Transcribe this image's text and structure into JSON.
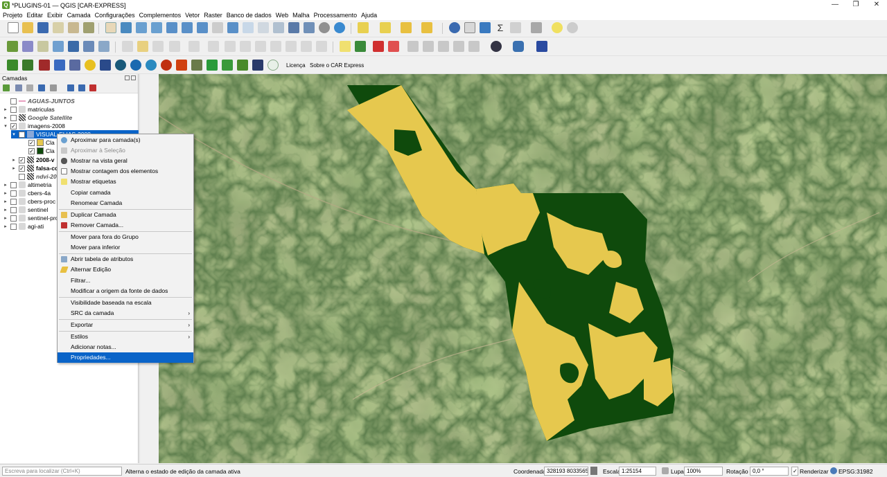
{
  "window": {
    "title": "*PLUGINS-01 — QGIS [CAR-EXPRESS]",
    "minimize": "—",
    "restore": "❐",
    "close": "✕"
  },
  "menu": [
    "Projeto",
    "Editar",
    "Exibir",
    "Camada",
    "Configurações",
    "Complementos",
    "Vetor",
    "Raster",
    "Banco de dados",
    "Web",
    "Malha",
    "Processamento",
    "Ajuda"
  ],
  "plugin_toolbar": {
    "licenca": "Licença",
    "sobre": "Sobre o CAR Express"
  },
  "layers_panel": {
    "title": "Camadas",
    "items": [
      {
        "label": "AGUAS-JUNTOS",
        "italic": true
      },
      {
        "label": "matriculas"
      },
      {
        "label": "Google Satellite",
        "italic": true
      },
      {
        "label": "imagens-2008",
        "checked": "✓",
        "expanded": "▾"
      },
      {
        "label": "VISUAL-ELIAS-2008",
        "checked": "✓"
      },
      {
        "label": "Cla",
        "checked": "✓"
      },
      {
        "label": "Cla",
        "checked": "✓"
      },
      {
        "label": "2008-v",
        "checked": "✓"
      },
      {
        "label": "falsa-co",
        "checked": "✓"
      },
      {
        "label": "ndvi-20"
      },
      {
        "label": "altimetria"
      },
      {
        "label": "cbers-4a"
      },
      {
        "label": "cbers-proc"
      },
      {
        "label": "sentinel"
      },
      {
        "label": "sentinel-pro"
      },
      {
        "label": "agi-ati"
      }
    ]
  },
  "context_menu": {
    "items": [
      {
        "label": "Aproximar para camada(s)"
      },
      {
        "label": "Aproximar à Seleção"
      },
      {
        "label": "Mostrar na vista geral"
      },
      {
        "label": "Mostrar contagem dos elementos"
      },
      {
        "label": "Mostrar etiquetas"
      },
      {
        "label": "Copiar camada"
      },
      {
        "label": "Renomear Camada"
      },
      {
        "label": "Duplicar Camada"
      },
      {
        "label": "Remover Camada..."
      },
      {
        "label": "Mover para fora do Grupo"
      },
      {
        "label": "Mover para inferior"
      },
      {
        "label": "Abrir tabela de atributos"
      },
      {
        "label": "Alternar Edição"
      },
      {
        "label": "Filtrar..."
      },
      {
        "label": "Modificar a origem da fonte de dados"
      },
      {
        "label": "Visibilidade baseada na escala"
      },
      {
        "label": "SRC da camada"
      },
      {
        "label": "Exportar"
      },
      {
        "label": "Estilos"
      },
      {
        "label": "Adicionar notas..."
      },
      {
        "label": "Propriedades..."
      }
    ],
    "submenu_arrow": "›"
  },
  "status": {
    "search_placeholder": "Escreva para localizar (Ctrl+K)",
    "message": "Alterna o estado de edição da camada ativa",
    "coord_label": "Coordenada",
    "coord_value": "328193  8033565",
    "scale_label": "Escala",
    "scale_value": "1:25154",
    "lupa_label": "Lupa",
    "lupa_value": "100%",
    "rotation_label": "Rotação",
    "rotation_value": "0,0 °",
    "render_label": "Renderizar",
    "render_check": "✓",
    "crs": "EPSG:31982"
  },
  "colors": {
    "yellow": "#e6c84e",
    "dark_green": "#0f4a0c",
    "satellite_base": "#6b7a4a",
    "selection": "#0a64c8"
  }
}
